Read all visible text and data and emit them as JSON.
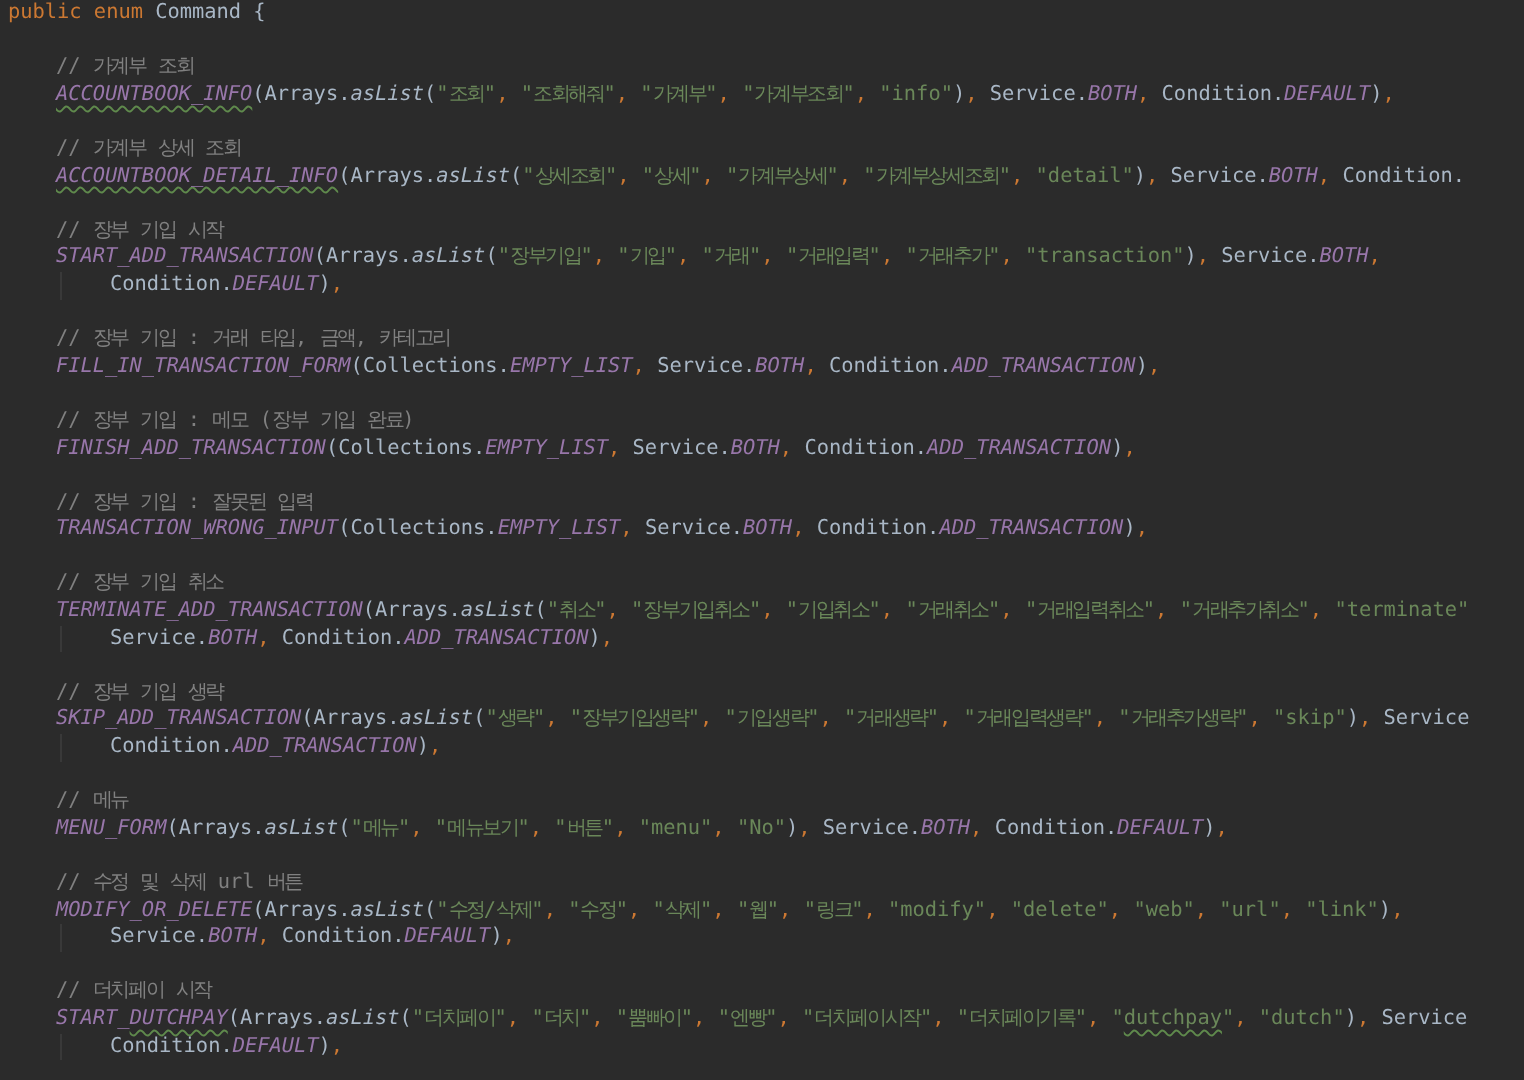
{
  "editor": {
    "header": [
      {
        "kind": "kw",
        "text": "public enum"
      },
      {
        "kind": "plain",
        "text": " Command {"
      }
    ],
    "entries": [
      {
        "comment": "// 가계부 조회",
        "lines": [
          {
            "kind": "code",
            "tokens": [
              {
                "kind": "cst_warn",
                "text": "ACCOUNTBOOK_INFO"
              },
              {
                "kind": "plain",
                "text": "(Arrays."
              },
              {
                "kind": "mth",
                "text": "asList"
              },
              {
                "kind": "plain",
                "text": "("
              },
              {
                "kind": "str",
                "text": "\"조회\""
              },
              {
                "kind": "punc",
                "text": ", "
              },
              {
                "kind": "str",
                "text": "\"조회해줘\""
              },
              {
                "kind": "punc",
                "text": ", "
              },
              {
                "kind": "str",
                "text": "\"가계부\""
              },
              {
                "kind": "punc",
                "text": ", "
              },
              {
                "kind": "str",
                "text": "\"가계부조회\""
              },
              {
                "kind": "punc",
                "text": ", "
              },
              {
                "kind": "str",
                "text": "\"info\""
              },
              {
                "kind": "plain",
                "text": ")"
              },
              {
                "kind": "punc",
                "text": ", "
              },
              {
                "kind": "plain",
                "text": "Service."
              },
              {
                "kind": "cst",
                "text": "BOTH"
              },
              {
                "kind": "punc",
                "text": ", "
              },
              {
                "kind": "plain",
                "text": "Condition."
              },
              {
                "kind": "cst",
                "text": "DEFAULT"
              },
              {
                "kind": "plain",
                "text": ")"
              },
              {
                "kind": "punc",
                "text": ","
              }
            ]
          }
        ]
      },
      {
        "comment": "// 가계부 상세 조회",
        "lines": [
          {
            "kind": "code",
            "tokens": [
              {
                "kind": "cst_warn",
                "text": "ACCOUNTBOOK_DETAIL_INFO"
              },
              {
                "kind": "plain",
                "text": "(Arrays."
              },
              {
                "kind": "mth",
                "text": "asList"
              },
              {
                "kind": "plain",
                "text": "("
              },
              {
                "kind": "str",
                "text": "\"상세조회\""
              },
              {
                "kind": "punc",
                "text": ", "
              },
              {
                "kind": "str",
                "text": "\"상세\""
              },
              {
                "kind": "punc",
                "text": ", "
              },
              {
                "kind": "str",
                "text": "\"가계부상세\""
              },
              {
                "kind": "punc",
                "text": ", "
              },
              {
                "kind": "str",
                "text": "\"가계부상세조회\""
              },
              {
                "kind": "punc",
                "text": ", "
              },
              {
                "kind": "str",
                "text": "\"detail\""
              },
              {
                "kind": "plain",
                "text": ")"
              },
              {
                "kind": "punc",
                "text": ", "
              },
              {
                "kind": "plain",
                "text": "Service."
              },
              {
                "kind": "cst",
                "text": "BOTH"
              },
              {
                "kind": "punc",
                "text": ", "
              },
              {
                "kind": "plain",
                "text": "Condition."
              }
            ]
          }
        ]
      },
      {
        "comment": "// 장부 기입 시작",
        "lines": [
          {
            "kind": "code",
            "tokens": [
              {
                "kind": "cst",
                "text": "START_ADD_TRANSACTION"
              },
              {
                "kind": "plain",
                "text": "(Arrays."
              },
              {
                "kind": "mth",
                "text": "asList"
              },
              {
                "kind": "plain",
                "text": "("
              },
              {
                "kind": "str",
                "text": "\"장부기입\""
              },
              {
                "kind": "punc",
                "text": ", "
              },
              {
                "kind": "str",
                "text": "\"기입\""
              },
              {
                "kind": "punc",
                "text": ", "
              },
              {
                "kind": "str",
                "text": "\"거래\""
              },
              {
                "kind": "punc",
                "text": ", "
              },
              {
                "kind": "str",
                "text": "\"거래입력\""
              },
              {
                "kind": "punc",
                "text": ", "
              },
              {
                "kind": "str",
                "text": "\"거래추가\""
              },
              {
                "kind": "punc",
                "text": ", "
              },
              {
                "kind": "str",
                "text": "\"transaction\""
              },
              {
                "kind": "plain",
                "text": ")"
              },
              {
                "kind": "punc",
                "text": ", "
              },
              {
                "kind": "plain",
                "text": "Service."
              },
              {
                "kind": "cst",
                "text": "BOTH"
              },
              {
                "kind": "punc",
                "text": ","
              }
            ]
          },
          {
            "kind": "continuation",
            "tokens": [
              {
                "kind": "plain",
                "text": "Condition."
              },
              {
                "kind": "cst",
                "text": "DEFAULT"
              },
              {
                "kind": "plain",
                "text": ")"
              },
              {
                "kind": "punc",
                "text": ","
              }
            ]
          }
        ]
      },
      {
        "comment": "// 장부 기입 : 거래 타입, 금액, 카테고리",
        "lines": [
          {
            "kind": "code",
            "tokens": [
              {
                "kind": "cst",
                "text": "FILL_IN_TRANSACTION_FORM"
              },
              {
                "kind": "plain",
                "text": "(Collections."
              },
              {
                "kind": "cst",
                "text": "EMPTY_LIST"
              },
              {
                "kind": "punc",
                "text": ", "
              },
              {
                "kind": "plain",
                "text": "Service."
              },
              {
                "kind": "cst",
                "text": "BOTH"
              },
              {
                "kind": "punc",
                "text": ", "
              },
              {
                "kind": "plain",
                "text": "Condition."
              },
              {
                "kind": "cst",
                "text": "ADD_TRANSACTION"
              },
              {
                "kind": "plain",
                "text": ")"
              },
              {
                "kind": "punc",
                "text": ","
              }
            ]
          }
        ]
      },
      {
        "comment": "// 장부 기입 : 메모 (장부 기입 완료)",
        "lines": [
          {
            "kind": "code",
            "tokens": [
              {
                "kind": "cst",
                "text": "FINISH_ADD_TRANSACTION"
              },
              {
                "kind": "plain",
                "text": "(Collections."
              },
              {
                "kind": "cst",
                "text": "EMPTY_LIST"
              },
              {
                "kind": "punc",
                "text": ", "
              },
              {
                "kind": "plain",
                "text": "Service."
              },
              {
                "kind": "cst",
                "text": "BOTH"
              },
              {
                "kind": "punc",
                "text": ", "
              },
              {
                "kind": "plain",
                "text": "Condition."
              },
              {
                "kind": "cst",
                "text": "ADD_TRANSACTION"
              },
              {
                "kind": "plain",
                "text": ")"
              },
              {
                "kind": "punc",
                "text": ","
              }
            ]
          }
        ]
      },
      {
        "comment": "// 장부 기입 : 잘못된 입력",
        "lines": [
          {
            "kind": "code",
            "tokens": [
              {
                "kind": "cst",
                "text": "TRANSACTION_WRONG_INPUT"
              },
              {
                "kind": "plain",
                "text": "(Collections."
              },
              {
                "kind": "cst",
                "text": "EMPTY_LIST"
              },
              {
                "kind": "punc",
                "text": ", "
              },
              {
                "kind": "plain",
                "text": "Service."
              },
              {
                "kind": "cst",
                "text": "BOTH"
              },
              {
                "kind": "punc",
                "text": ", "
              },
              {
                "kind": "plain",
                "text": "Condition."
              },
              {
                "kind": "cst",
                "text": "ADD_TRANSACTION"
              },
              {
                "kind": "plain",
                "text": ")"
              },
              {
                "kind": "punc",
                "text": ","
              }
            ]
          }
        ]
      },
      {
        "comment": "// 장부 기입 취소",
        "lines": [
          {
            "kind": "code",
            "tokens": [
              {
                "kind": "cst",
                "text": "TERMINATE_ADD_TRANSACTION"
              },
              {
                "kind": "plain",
                "text": "(Arrays."
              },
              {
                "kind": "mth",
                "text": "asList"
              },
              {
                "kind": "plain",
                "text": "("
              },
              {
                "kind": "str",
                "text": "\"취소\""
              },
              {
                "kind": "punc",
                "text": ", "
              },
              {
                "kind": "str",
                "text": "\"장부기입취소\""
              },
              {
                "kind": "punc",
                "text": ", "
              },
              {
                "kind": "str",
                "text": "\"기입취소\""
              },
              {
                "kind": "punc",
                "text": ", "
              },
              {
                "kind": "str",
                "text": "\"거래취소\""
              },
              {
                "kind": "punc",
                "text": ", "
              },
              {
                "kind": "str",
                "text": "\"거래입력취소\""
              },
              {
                "kind": "punc",
                "text": ", "
              },
              {
                "kind": "str",
                "text": "\"거래추가취소\""
              },
              {
                "kind": "punc",
                "text": ", "
              },
              {
                "kind": "str",
                "text": "\"terminate\""
              }
            ]
          },
          {
            "kind": "continuation",
            "tokens": [
              {
                "kind": "plain",
                "text": "Service."
              },
              {
                "kind": "cst",
                "text": "BOTH"
              },
              {
                "kind": "punc",
                "text": ", "
              },
              {
                "kind": "plain",
                "text": "Condition."
              },
              {
                "kind": "cst",
                "text": "ADD_TRANSACTION"
              },
              {
                "kind": "plain",
                "text": ")"
              },
              {
                "kind": "punc",
                "text": ","
              }
            ]
          }
        ]
      },
      {
        "comment": "// 장부 기입 생략",
        "lines": [
          {
            "kind": "code",
            "tokens": [
              {
                "kind": "cst",
                "text": "SKIP_ADD_TRANSACTION"
              },
              {
                "kind": "plain",
                "text": "(Arrays."
              },
              {
                "kind": "mth",
                "text": "asList"
              },
              {
                "kind": "plain",
                "text": "("
              },
              {
                "kind": "str",
                "text": "\"생략\""
              },
              {
                "kind": "punc",
                "text": ", "
              },
              {
                "kind": "str",
                "text": "\"장부기입생략\""
              },
              {
                "kind": "punc",
                "text": ", "
              },
              {
                "kind": "str",
                "text": "\"기입생략\""
              },
              {
                "kind": "punc",
                "text": ", "
              },
              {
                "kind": "str",
                "text": "\"거래생략\""
              },
              {
                "kind": "punc",
                "text": ", "
              },
              {
                "kind": "str",
                "text": "\"거래입력생략\""
              },
              {
                "kind": "punc",
                "text": ", "
              },
              {
                "kind": "str",
                "text": "\"거래추가생략\""
              },
              {
                "kind": "punc",
                "text": ", "
              },
              {
                "kind": "str",
                "text": "\"skip\""
              },
              {
                "kind": "plain",
                "text": ")"
              },
              {
                "kind": "punc",
                "text": ", "
              },
              {
                "kind": "plain",
                "text": "Service"
              }
            ]
          },
          {
            "kind": "continuation",
            "tokens": [
              {
                "kind": "plain",
                "text": "Condition."
              },
              {
                "kind": "cst",
                "text": "ADD_TRANSACTION"
              },
              {
                "kind": "plain",
                "text": ")"
              },
              {
                "kind": "punc",
                "text": ","
              }
            ]
          }
        ]
      },
      {
        "comment": "// 메뉴",
        "lines": [
          {
            "kind": "code",
            "tokens": [
              {
                "kind": "cst",
                "text": "MENU_FORM"
              },
              {
                "kind": "plain",
                "text": "(Arrays."
              },
              {
                "kind": "mth",
                "text": "asList"
              },
              {
                "kind": "plain",
                "text": "("
              },
              {
                "kind": "str",
                "text": "\"메뉴\""
              },
              {
                "kind": "punc",
                "text": ", "
              },
              {
                "kind": "str",
                "text": "\"메뉴보기\""
              },
              {
                "kind": "punc",
                "text": ", "
              },
              {
                "kind": "str",
                "text": "\"버튼\""
              },
              {
                "kind": "punc",
                "text": ", "
              },
              {
                "kind": "str",
                "text": "\"menu\""
              },
              {
                "kind": "punc",
                "text": ", "
              },
              {
                "kind": "str",
                "text": "\"No\""
              },
              {
                "kind": "plain",
                "text": ")"
              },
              {
                "kind": "punc",
                "text": ", "
              },
              {
                "kind": "plain",
                "text": "Service."
              },
              {
                "kind": "cst",
                "text": "BOTH"
              },
              {
                "kind": "punc",
                "text": ", "
              },
              {
                "kind": "plain",
                "text": "Condition."
              },
              {
                "kind": "cst",
                "text": "DEFAULT"
              },
              {
                "kind": "plain",
                "text": ")"
              },
              {
                "kind": "punc",
                "text": ","
              }
            ]
          }
        ]
      },
      {
        "comment": "// 수정 및 삭제 url 버튼",
        "lines": [
          {
            "kind": "code",
            "tokens": [
              {
                "kind": "cst",
                "text": "MODIFY_OR_DELETE"
              },
              {
                "kind": "plain",
                "text": "(Arrays."
              },
              {
                "kind": "mth",
                "text": "asList"
              },
              {
                "kind": "plain",
                "text": "("
              },
              {
                "kind": "str",
                "text": "\"수정/삭제\""
              },
              {
                "kind": "punc",
                "text": ", "
              },
              {
                "kind": "str",
                "text": "\"수정\""
              },
              {
                "kind": "punc",
                "text": ", "
              },
              {
                "kind": "str",
                "text": "\"삭제\""
              },
              {
                "kind": "punc",
                "text": ", "
              },
              {
                "kind": "str",
                "text": "\"웹\""
              },
              {
                "kind": "punc",
                "text": ", "
              },
              {
                "kind": "str",
                "text": "\"링크\""
              },
              {
                "kind": "punc",
                "text": ", "
              },
              {
                "kind": "str",
                "text": "\"modify\""
              },
              {
                "kind": "punc",
                "text": ", "
              },
              {
                "kind": "str",
                "text": "\"delete\""
              },
              {
                "kind": "punc",
                "text": ", "
              },
              {
                "kind": "str",
                "text": "\"web\""
              },
              {
                "kind": "punc",
                "text": ", "
              },
              {
                "kind": "str",
                "text": "\"url\""
              },
              {
                "kind": "punc",
                "text": ", "
              },
              {
                "kind": "str",
                "text": "\"link\""
              },
              {
                "kind": "plain",
                "text": ")"
              },
              {
                "kind": "punc",
                "text": ","
              }
            ]
          },
          {
            "kind": "continuation",
            "tokens": [
              {
                "kind": "plain",
                "text": "Service."
              },
              {
                "kind": "cst",
                "text": "BOTH"
              },
              {
                "kind": "punc",
                "text": ", "
              },
              {
                "kind": "plain",
                "text": "Condition."
              },
              {
                "kind": "cst",
                "text": "DEFAULT"
              },
              {
                "kind": "plain",
                "text": ")"
              },
              {
                "kind": "punc",
                "text": ","
              }
            ]
          }
        ]
      },
      {
        "comment": "// 더치페이 시작",
        "lines": [
          {
            "kind": "code",
            "tokens": [
              {
                "kind": "cst",
                "text": "START_"
              },
              {
                "kind": "cst_warn",
                "text": "DUTCHPAY"
              },
              {
                "kind": "plain",
                "text": "(Arrays."
              },
              {
                "kind": "mth",
                "text": "asList"
              },
              {
                "kind": "plain",
                "text": "("
              },
              {
                "kind": "str",
                "text": "\"더치페이\""
              },
              {
                "kind": "punc",
                "text": ", "
              },
              {
                "kind": "str",
                "text": "\"더치\""
              },
              {
                "kind": "punc",
                "text": ", "
              },
              {
                "kind": "str",
                "text": "\"뿜빠이\""
              },
              {
                "kind": "punc",
                "text": ", "
              },
              {
                "kind": "str",
                "text": "\"엔빵\""
              },
              {
                "kind": "punc",
                "text": ", "
              },
              {
                "kind": "str",
                "text": "\"더치페이시작\""
              },
              {
                "kind": "punc",
                "text": ", "
              },
              {
                "kind": "str",
                "text": "\"더치페이기록\""
              },
              {
                "kind": "punc",
                "text": ", "
              },
              {
                "kind": "str",
                "text": "\""
              },
              {
                "kind": "str_warn",
                "text": "dutchpay"
              },
              {
                "kind": "str",
                "text": "\""
              },
              {
                "kind": "punc",
                "text": ", "
              },
              {
                "kind": "str",
                "text": "\"dutch\""
              },
              {
                "kind": "plain",
                "text": ")"
              },
              {
                "kind": "punc",
                "text": ", "
              },
              {
                "kind": "plain",
                "text": "Service"
              }
            ]
          },
          {
            "kind": "continuation",
            "tokens": [
              {
                "kind": "plain",
                "text": "Condition."
              },
              {
                "kind": "cst",
                "text": "DEFAULT"
              },
              {
                "kind": "plain",
                "text": ")"
              },
              {
                "kind": "punc",
                "text": ","
              }
            ]
          }
        ]
      }
    ]
  }
}
